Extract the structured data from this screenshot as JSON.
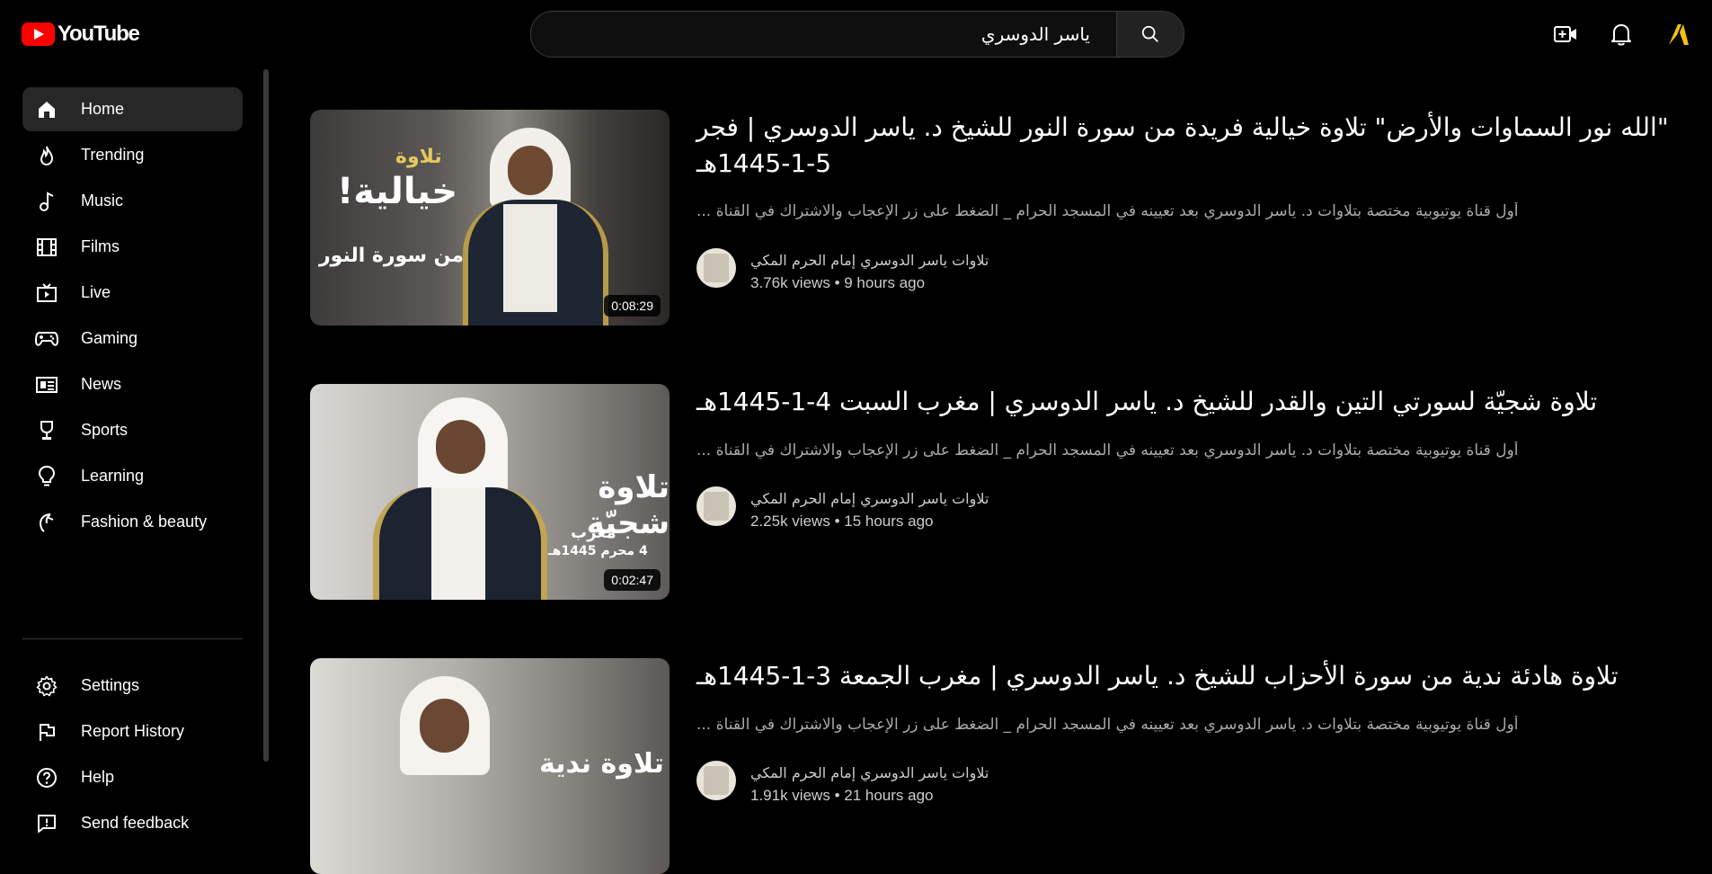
{
  "header": {
    "logo_text": "YouTube",
    "search_value": "ياسر الدوسري",
    "icons": [
      "create-video-icon",
      "notifications-icon",
      "account-icon"
    ]
  },
  "colors": {
    "brand": "#ff0000",
    "account_accent": "#f4c20d",
    "background": "#000000",
    "active_nav": "#272727"
  },
  "sidebar": {
    "items": [
      {
        "label": "Home",
        "icon": "home-icon",
        "active": true
      },
      {
        "label": "Trending",
        "icon": "trending-icon"
      },
      {
        "label": "Music",
        "icon": "music-icon"
      },
      {
        "label": "Films",
        "icon": "films-icon"
      },
      {
        "label": "Live",
        "icon": "live-icon"
      },
      {
        "label": "Gaming",
        "icon": "gaming-icon"
      },
      {
        "label": "News",
        "icon": "news-icon"
      },
      {
        "label": "Sports",
        "icon": "sports-icon"
      },
      {
        "label": "Learning",
        "icon": "learning-icon"
      },
      {
        "label": "Fashion & beauty",
        "icon": "fashion-icon"
      }
    ],
    "secondary": [
      {
        "label": "Settings",
        "icon": "settings-icon"
      },
      {
        "label": "Report History",
        "icon": "report-flag-icon"
      },
      {
        "label": "Help",
        "icon": "help-icon"
      },
      {
        "label": "Send feedback",
        "icon": "feedback-icon"
      }
    ]
  },
  "videos": [
    {
      "title": "\"الله نور السماوات والأرض\" تلاوة خيالية فريدة من سورة النور للشيخ د. ياسر الدوسري | فجر 5-1-1445هـ",
      "description": "أول قناة يوتيوبية مختصة بتلاوات د. ياسر الدوسري بعد تعيينه في المسجد الحرام _ الضغط على زر الإعجاب والاشتراك في القناة ...",
      "channel": "تلاوات ياسر الدوسري إمام الحرم المكي",
      "views": "3.76k views",
      "age": "9 hours ago",
      "duration": "0:08:29"
    },
    {
      "title": "تلاوة شجيّة لسورتي التين والقدر للشيخ د. ياسر الدوسري | مغرب السبت 4-1-1445هـ",
      "description": "أول قناة يوتيوبية مختصة بتلاوات د. ياسر الدوسري بعد تعيينه في المسجد الحرام _ الضغط على زر الإعجاب والاشتراك في القناة ...",
      "channel": "تلاوات ياسر الدوسري إمام الحرم المكي",
      "views": "2.25k views",
      "age": "15 hours ago",
      "duration": "0:02:47"
    },
    {
      "title": "تلاوة هادئة ندية من سورة الأحزاب للشيخ د. ياسر الدوسري | مغرب الجمعة 3-1-1445هـ",
      "description": "أول قناة يوتيوبية مختصة بتلاوات د. ياسر الدوسري بعد تعيينه في المسجد الحرام _ الضغط على زر الإعجاب والاشتراك في القناة ...",
      "channel": "تلاوات ياسر الدوسري إمام الحرم المكي",
      "views": "1.91k views",
      "age": "21 hours ago",
      "duration": ""
    }
  ],
  "separator": "•",
  "thumb_texts": [
    {
      "line1": "تلاوة",
      "line2": "خيالية!",
      "line3": "من سورة النور"
    },
    {
      "line1": "تلاوة شجيّة",
      "line2": "مغرب",
      "line3": "4 محرم 1445هـ"
    },
    {
      "line1": "تلاوة ندية",
      "line2": "",
      "line3": ""
    }
  ]
}
